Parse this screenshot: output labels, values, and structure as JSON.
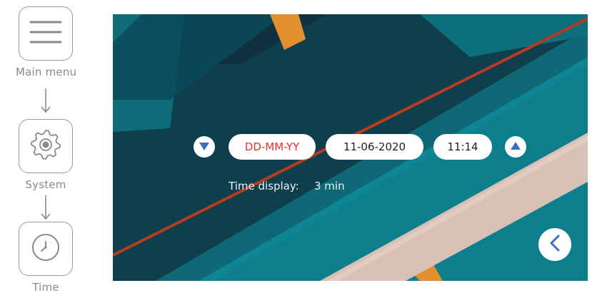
{
  "flow": {
    "steps": [
      {
        "label": "Main menu",
        "icon": "menu-icon"
      },
      {
        "label": "System",
        "icon": "gear-icon"
      },
      {
        "label": "Time",
        "icon": "clock-icon"
      }
    ]
  },
  "screen": {
    "controls": {
      "down_icon": "triangle-down-icon",
      "up_icon": "triangle-up-icon",
      "date_format": "DD-MM-YY",
      "date": "11-06-2020",
      "time": "11:14"
    },
    "time_display": {
      "label": "Time display:",
      "value": "3 min"
    },
    "back_icon": "chevron-left-icon"
  },
  "colors": {
    "accent_blue": "#3a6fc4",
    "active_red": "#e5322d",
    "nav_gray": "#8a8a8a"
  }
}
